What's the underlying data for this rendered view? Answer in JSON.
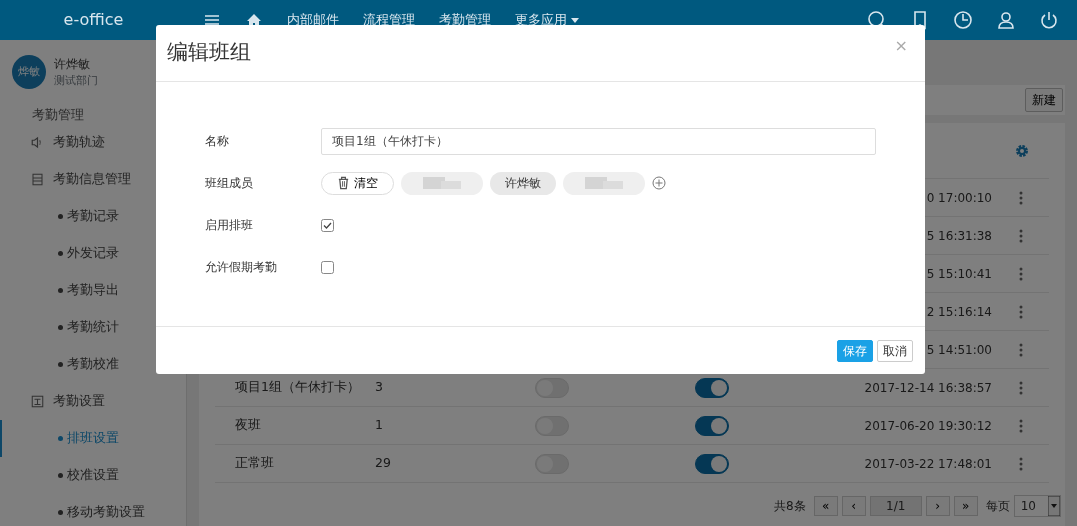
{
  "topbar": {
    "logo": "e-office",
    "nav": [
      {
        "label": "内部邮件",
        "dropdown": false
      },
      {
        "label": "流程管理",
        "dropdown": false
      },
      {
        "label": "考勤管理",
        "dropdown": false
      },
      {
        "label": "更多应用",
        "dropdown": true
      }
    ]
  },
  "user": {
    "avatar": "烨敏",
    "name": "许烨敏",
    "department": "测试部门"
  },
  "sidebar": {
    "heading": "考勤管理",
    "items": [
      {
        "label": "考勤轨迹",
        "selected": false
      },
      {
        "label": "考勤信息管理",
        "selected": false,
        "children": [
          {
            "label": "考勤记录",
            "selected": false
          },
          {
            "label": "外发记录",
            "selected": false
          },
          {
            "label": "考勤导出",
            "selected": false
          },
          {
            "label": "考勤统计",
            "selected": false
          },
          {
            "label": "考勤校准",
            "selected": false
          }
        ]
      },
      {
        "label": "考勤设置",
        "selected": false,
        "children": [
          {
            "label": "排班设置",
            "selected": true
          },
          {
            "label": "校准设置",
            "selected": false
          },
          {
            "label": "移动考勤设置",
            "selected": false
          }
        ]
      }
    ]
  },
  "toolbar": {
    "new_button": "新建"
  },
  "table": {
    "rows": [
      {
        "updated": "0 17:00:10"
      },
      {
        "updated": "5 16:31:38"
      },
      {
        "updated": "5 15:10:41"
      },
      {
        "updated": "2 15:16:14"
      },
      {
        "updated": "5 14:51:00"
      },
      {
        "name": "项目1组（午休打卡）",
        "count": "3",
        "toggle_1": false,
        "toggle_2": true,
        "updated": "2017-12-14 16:38:57"
      },
      {
        "name": "夜班",
        "count": "1",
        "toggle_1": false,
        "toggle_2": true,
        "updated": "2017-06-20 19:30:12"
      },
      {
        "name": "正常班",
        "count": "29",
        "toggle_1": false,
        "toggle_2": true,
        "updated": "2017-03-22 17:48:01"
      }
    ]
  },
  "pagination": {
    "total": "共8条",
    "buttons": [
      "«",
      "‹"
    ],
    "page": "1/1",
    "buttons_after": [
      "›",
      "»"
    ],
    "per_page_label": "每页",
    "per_page": "10"
  },
  "modal": {
    "title": "编辑班组",
    "close": "×",
    "fields": [
      {
        "kind": "text",
        "label": "名称",
        "value": "项目1组（午休打卡）"
      },
      {
        "kind": "members",
        "label": "班组成员",
        "clear_button": "清空",
        "members": [
          {
            "kind": "redacted"
          },
          {
            "kind": "name",
            "name": "许烨敏"
          },
          {
            "kind": "redacted"
          }
        ]
      },
      {
        "kind": "checkbox",
        "label": "启用排班",
        "checked": true
      },
      {
        "kind": "checkbox",
        "label": "允许假期考勤",
        "checked": false
      }
    ],
    "buttons": [
      {
        "label": "保存",
        "kind": "primary"
      },
      {
        "label": "取消",
        "kind": "secondary"
      }
    ]
  }
}
